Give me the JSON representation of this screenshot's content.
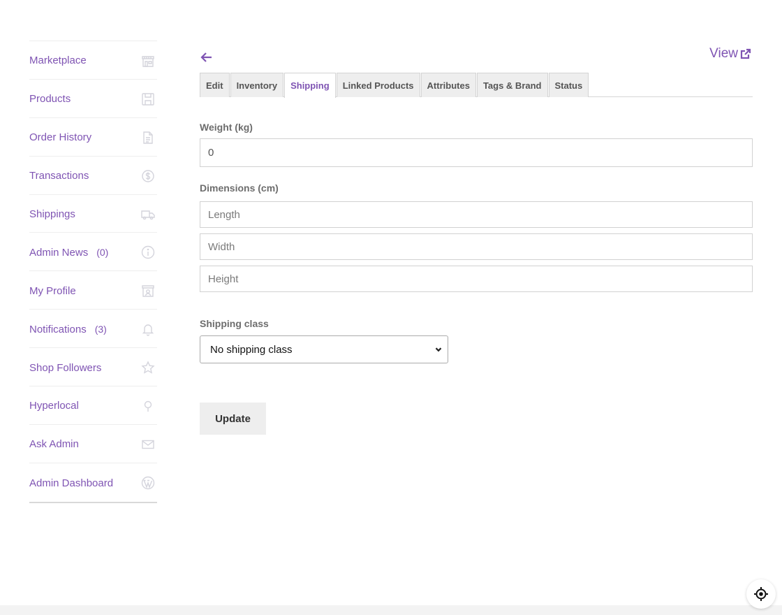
{
  "sidebar": {
    "items": [
      {
        "label": "Marketplace",
        "count": "",
        "icon": "store-icon"
      },
      {
        "label": "Products",
        "count": "",
        "icon": "save-icon"
      },
      {
        "label": "Order History",
        "count": "",
        "icon": "document-icon"
      },
      {
        "label": "Transactions",
        "count": "",
        "icon": "dollar-icon"
      },
      {
        "label": "Shippings",
        "count": "",
        "icon": "truck-icon"
      },
      {
        "label": "Admin News",
        "count": "(0)",
        "icon": "info-icon"
      },
      {
        "label": "My Profile",
        "count": "",
        "icon": "profile-icon"
      },
      {
        "label": "Notifications",
        "count": "(3)",
        "icon": "bell-icon"
      },
      {
        "label": "Shop Followers",
        "count": "",
        "icon": "star-icon"
      },
      {
        "label": "Hyperlocal",
        "count": "",
        "icon": "pin-icon"
      },
      {
        "label": "Ask Admin",
        "count": "",
        "icon": "mail-icon"
      },
      {
        "label": "Admin Dashboard",
        "count": "",
        "icon": "wordpress-icon"
      }
    ]
  },
  "header": {
    "view_label": "View"
  },
  "tabs": [
    {
      "label": "Edit",
      "active": false
    },
    {
      "label": "Inventory",
      "active": false
    },
    {
      "label": "Shipping",
      "active": true
    },
    {
      "label": "Linked Products",
      "active": false
    },
    {
      "label": "Attributes",
      "active": false
    },
    {
      "label": "Tags & Brand",
      "active": false
    },
    {
      "label": "Status",
      "active": false
    }
  ],
  "form": {
    "weight_label": "Weight (kg)",
    "weight_value": "0",
    "dimensions_label": "Dimensions (cm)",
    "length_placeholder": "Length",
    "width_placeholder": "Width",
    "height_placeholder": "Height",
    "shipping_class_label": "Shipping class",
    "shipping_class_value": "No shipping class",
    "update_label": "Update"
  },
  "colors": {
    "accent": "#7f54b3",
    "icon_muted": "#d4d4dc",
    "tab_bg": "#eeeeee"
  }
}
